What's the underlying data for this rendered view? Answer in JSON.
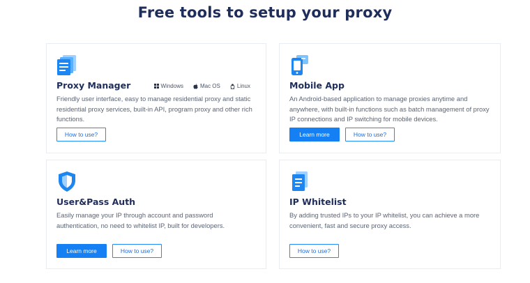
{
  "page": {
    "title": "Free tools to setup your proxy"
  },
  "cards": {
    "proxy_manager": {
      "title": "Proxy Manager",
      "icon": "document-stack-icon",
      "description": "Friendly user interface, easy to manage residential proxy and static residential proxy services, built-in API, program proxy and other rich functions.",
      "os": [
        {
          "label": "Windows",
          "icon": "windows-icon"
        },
        {
          "label": "Mac OS",
          "icon": "apple-icon"
        },
        {
          "label": "Linux",
          "icon": "linux-icon"
        }
      ],
      "how_to_use": "How to use?"
    },
    "mobile_app": {
      "title": "Mobile App",
      "icon": "mobile-phone-icon",
      "description": "An Android-based application to manage proxies anytime and anywhere, with built-in functions such as batch management of proxy IP connections and IP switching for mobile devices.",
      "learn_more": "Learn more",
      "how_to_use": "How to use?"
    },
    "user_pass": {
      "title": "User&Pass Auth",
      "icon": "shield-icon",
      "description": "Easily manage your IP through account and password authentication, no need to whitelist IP, built for developers.",
      "learn_more": "Learn more",
      "how_to_use": "How to use?"
    },
    "ip_whitelist": {
      "title": "IP Whitelist",
      "icon": "document-list-icon",
      "description": "By adding trusted IPs to your IP whitelist, you can achieve a more convenient, fast and secure proxy access.",
      "how_to_use": "How to use?"
    }
  },
  "colors": {
    "accent": "#1580f4",
    "title": "#1f2d5a",
    "border": "#e9edf3"
  }
}
